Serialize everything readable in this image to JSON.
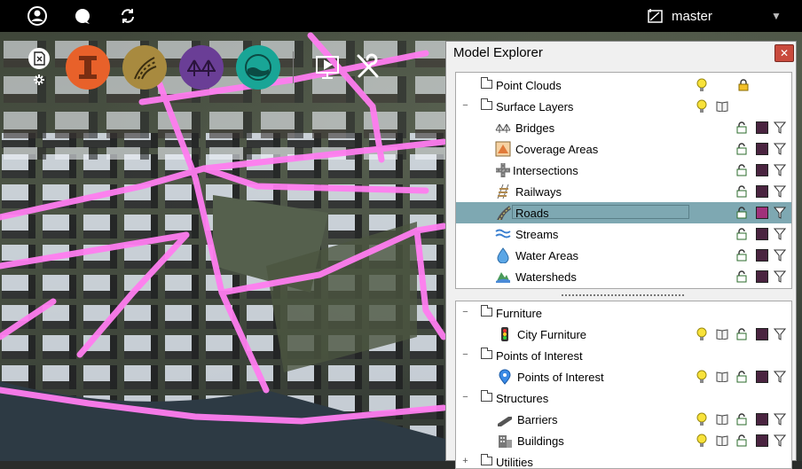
{
  "topbar": {
    "icons": [
      "user-icon",
      "chat-icon",
      "sync-icon"
    ],
    "branch": "master"
  },
  "tools": [
    "settings-icon",
    "interstate-icon",
    "road-icon",
    "bridge-icon",
    "water-icon",
    "presentation-icon",
    "tools-icon"
  ],
  "panel": {
    "title": "Model Explorer",
    "close": "✕",
    "pane1": [
      {
        "label": "Point Clouds",
        "type": "folder"
      },
      {
        "label": "Surface Layers",
        "type": "folder",
        "expand": "−"
      },
      {
        "label": "Bridges",
        "type": "layer"
      },
      {
        "label": "Coverage Areas",
        "type": "layer"
      },
      {
        "label": "Intersections",
        "type": "layer"
      },
      {
        "label": "Railways",
        "type": "layer"
      },
      {
        "label": "Roads",
        "type": "layer",
        "selected": true
      },
      {
        "label": "Streams",
        "type": "layer"
      },
      {
        "label": "Water Areas",
        "type": "layer"
      },
      {
        "label": "Watersheds",
        "type": "layer"
      }
    ],
    "pane2": [
      {
        "label": "Furniture",
        "type": "folder",
        "expand": "−"
      },
      {
        "label": "City Furniture",
        "type": "layer"
      },
      {
        "label": "Points of Interest",
        "type": "folder",
        "expand": "−"
      },
      {
        "label": "Points of Interest",
        "type": "layer"
      },
      {
        "label": "Structures",
        "type": "folder",
        "expand": "−"
      },
      {
        "label": "Barriers",
        "type": "layer"
      },
      {
        "label": "Buildings",
        "type": "layer"
      },
      {
        "label": "Utilities",
        "type": "folder",
        "expand": "+"
      }
    ]
  },
  "colors": {
    "road": "#ff7df0",
    "layer_swatch": "#4a2440",
    "roads_swatch": "#a0307a",
    "selection": "#7ea8b2"
  }
}
